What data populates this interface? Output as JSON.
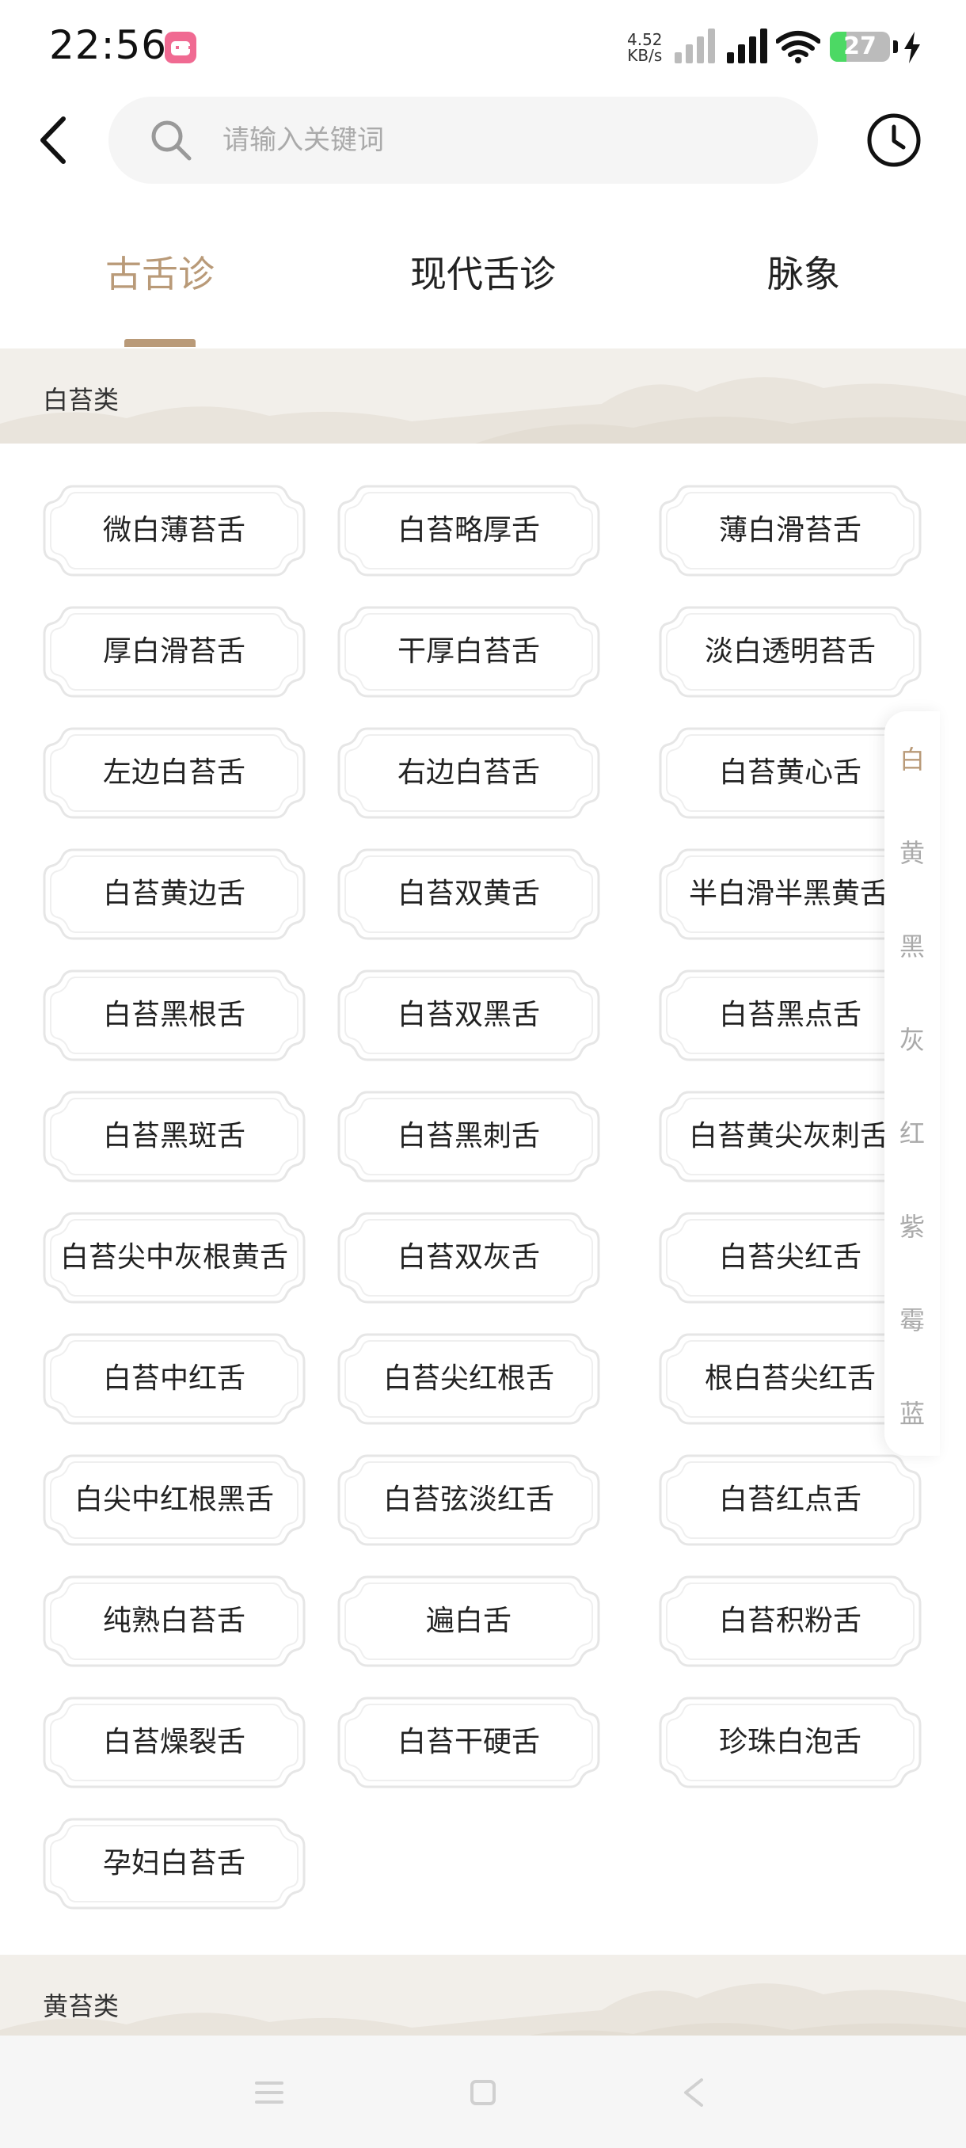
{
  "status_bar": {
    "time": "22:56",
    "net_speed_value": "4.52",
    "net_speed_unit": "KB/s",
    "battery_level": "27",
    "battery_percent": 27,
    "icons": [
      "app-notification-icon",
      "signal-weak-icon",
      "signal-strong-icon",
      "wifi-icon",
      "battery-icon",
      "charging-icon"
    ]
  },
  "header": {
    "back_icon": "chevron-left-icon",
    "search_icon": "search-icon",
    "search_placeholder": "请输入关键词",
    "search_value": "",
    "history_icon": "clock-icon"
  },
  "tabs": [
    {
      "label": "古舌诊",
      "active": true
    },
    {
      "label": "现代舌诊",
      "active": false
    },
    {
      "label": "脉象",
      "active": false
    }
  ],
  "sections": [
    {
      "title": "白苔类",
      "items": [
        "微白薄苔舌",
        "白苔略厚舌",
        "薄白滑苔舌",
        "厚白滑苔舌",
        "干厚白苔舌",
        "淡白透明苔舌",
        "左边白苔舌",
        "右边白苔舌",
        "白苔黄心舌",
        "白苔黄边舌",
        "白苔双黄舌",
        "半白滑半黑黄舌",
        "白苔黑根舌",
        "白苔双黑舌",
        "白苔黑点舌",
        "白苔黑斑舌",
        "白苔黑刺舌",
        "白苔黄尖灰刺舌",
        "白苔尖中灰根黄舌",
        "白苔双灰舌",
        "白苔尖红舌",
        "白苔中红舌",
        "白苔尖红根舌",
        "根白苔尖红舌",
        "白尖中红根黑舌",
        "白苔弦淡红舌",
        "白苔红点舌",
        "纯熟白苔舌",
        "遍白舌",
        "白苔积粉舌",
        "白苔燥裂舌",
        "白苔干硬舌",
        "珍珠白泡舌",
        "孕妇白苔舌"
      ]
    },
    {
      "title": "黄苔类",
      "items": []
    }
  ],
  "index": [
    {
      "label": "白",
      "active": true
    },
    {
      "label": "黄",
      "active": false
    },
    {
      "label": "黑",
      "active": false
    },
    {
      "label": "灰",
      "active": false
    },
    {
      "label": "红",
      "active": false
    },
    {
      "label": "紫",
      "active": false
    },
    {
      "label": "霉",
      "active": false
    },
    {
      "label": "蓝",
      "active": false
    }
  ],
  "nav_bar": {
    "buttons": [
      "menu-icon",
      "home-square-icon",
      "back-triangle-icon"
    ]
  },
  "colors": {
    "accent": "#b99a78",
    "section_bg": "#f2efea",
    "tag_border": "#e6e6e6"
  }
}
